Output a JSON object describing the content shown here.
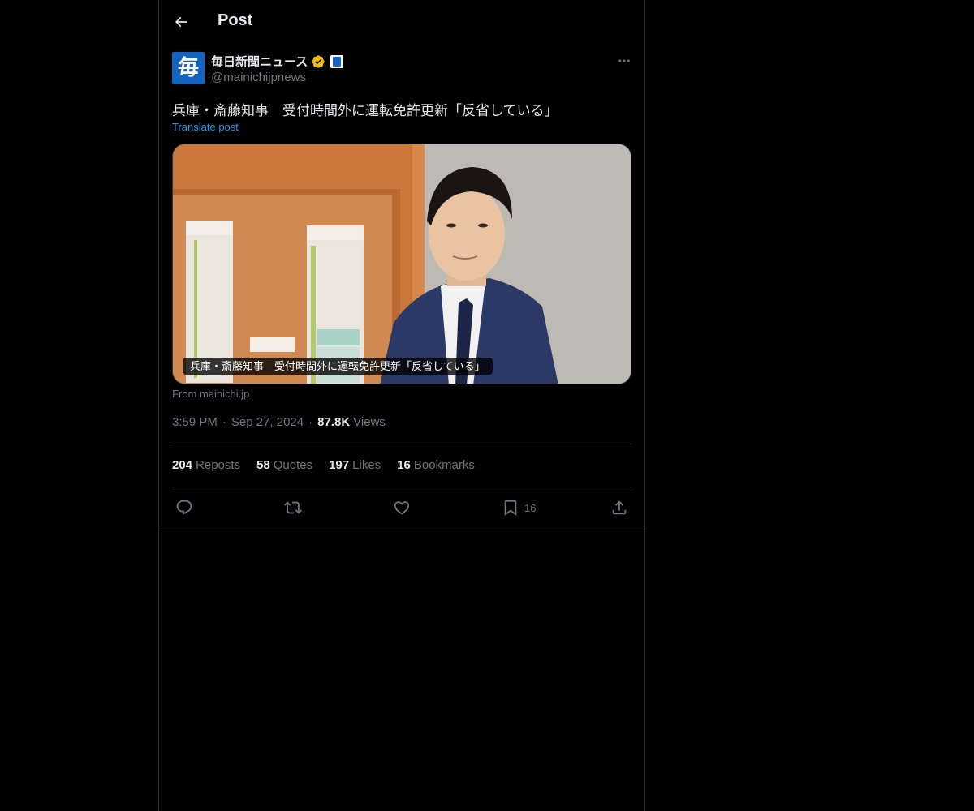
{
  "header": {
    "title": "Post"
  },
  "post": {
    "author": {
      "name": "毎日新聞ニュース",
      "handle": "@mainichijpnews",
      "avatar_glyph": "毎",
      "verified": true,
      "verified_color": "#f0b90b"
    },
    "text": "兵庫・斎藤知事　受付時間外に運転免許更新「反省している」",
    "translate_label": "Translate post",
    "media": {
      "caption": "兵庫・斎藤知事　受付時間外に運転免許更新「反省している」",
      "source": "From mainichi.jp"
    },
    "time": "3:59 PM",
    "date": "Sep 27, 2024",
    "views_count": "87.8K",
    "views_label": "Views",
    "separator": "·"
  },
  "stats": {
    "reposts": {
      "count": "204",
      "label": "Reposts"
    },
    "quotes": {
      "count": "58",
      "label": "Quotes"
    },
    "likes": {
      "count": "197",
      "label": "Likes"
    },
    "bookmarks": {
      "count": "16",
      "label": "Bookmarks"
    }
  },
  "actions": {
    "bookmark_count": "16",
    "icons": [
      "reply-icon",
      "repost-icon",
      "like-icon",
      "bookmark-icon",
      "share-icon"
    ]
  },
  "colors": {
    "background": "#000000",
    "text": "#e7e9ea",
    "muted": "#71767b",
    "link": "#1d9bf0",
    "border": "#2f3336"
  }
}
